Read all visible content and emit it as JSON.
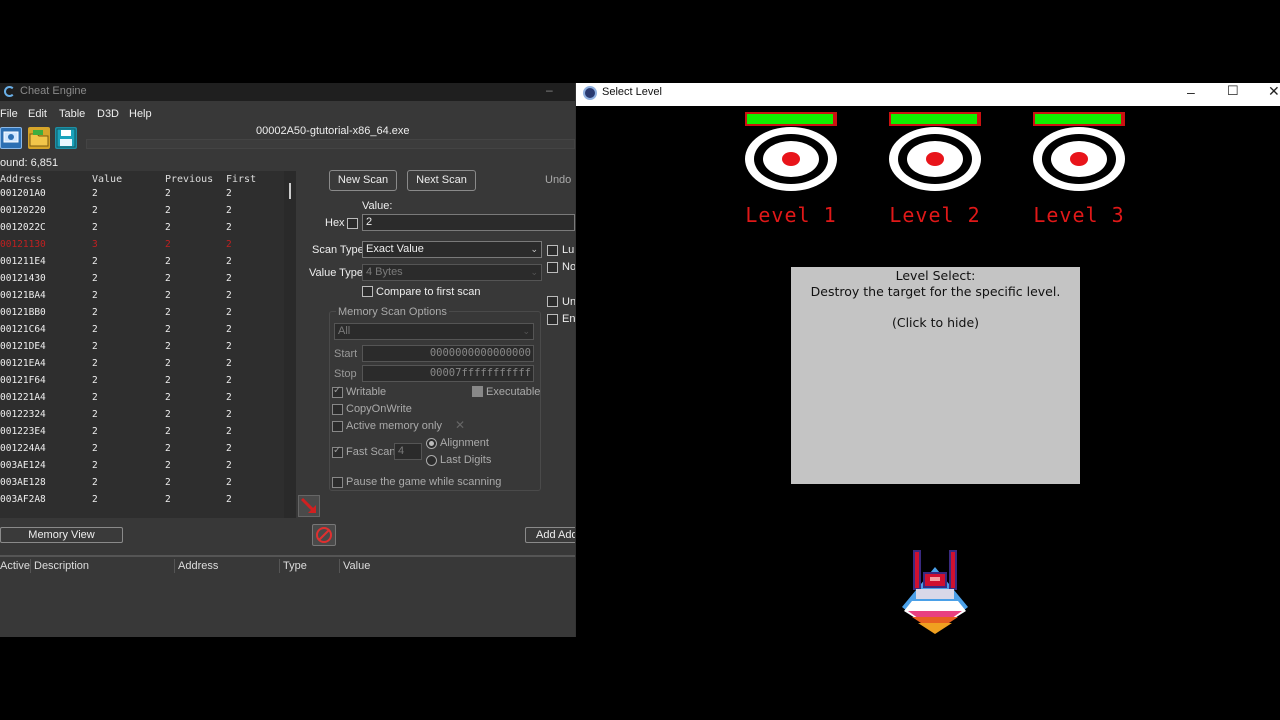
{
  "cheat_engine": {
    "title": "Cheat Engine",
    "menu": [
      "File",
      "Edit",
      "Table",
      "D3D",
      "Help"
    ],
    "process_name": "00002A50-gtutorial-x86_64.exe",
    "found_label": "ound: 6,851",
    "results_headers": [
      "Address",
      "Value",
      "Previous",
      "First"
    ],
    "results": [
      {
        "address": "001201A0",
        "value": "2",
        "previous": "2",
        "first": "2",
        "changed": false
      },
      {
        "address": "00120220",
        "value": "2",
        "previous": "2",
        "first": "2",
        "changed": false
      },
      {
        "address": "0012022C",
        "value": "2",
        "previous": "2",
        "first": "2",
        "changed": false
      },
      {
        "address": "00121130",
        "value": "3",
        "previous": "2",
        "first": "2",
        "changed": true
      },
      {
        "address": "001211E4",
        "value": "2",
        "previous": "2",
        "first": "2",
        "changed": false
      },
      {
        "address": "00121430",
        "value": "2",
        "previous": "2",
        "first": "2",
        "changed": false
      },
      {
        "address": "00121BA4",
        "value": "2",
        "previous": "2",
        "first": "2",
        "changed": false
      },
      {
        "address": "00121BB0",
        "value": "2",
        "previous": "2",
        "first": "2",
        "changed": false
      },
      {
        "address": "00121C64",
        "value": "2",
        "previous": "2",
        "first": "2",
        "changed": false
      },
      {
        "address": "00121DE4",
        "value": "2",
        "previous": "2",
        "first": "2",
        "changed": false
      },
      {
        "address": "00121EA4",
        "value": "2",
        "previous": "2",
        "first": "2",
        "changed": false
      },
      {
        "address": "00121F64",
        "value": "2",
        "previous": "2",
        "first": "2",
        "changed": false
      },
      {
        "address": "001221A4",
        "value": "2",
        "previous": "2",
        "first": "2",
        "changed": false
      },
      {
        "address": "00122324",
        "value": "2",
        "previous": "2",
        "first": "2",
        "changed": false
      },
      {
        "address": "001223E4",
        "value": "2",
        "previous": "2",
        "first": "2",
        "changed": false
      },
      {
        "address": "001224A4",
        "value": "2",
        "previous": "2",
        "first": "2",
        "changed": false
      },
      {
        "address": "003AE124",
        "value": "2",
        "previous": "2",
        "first": "2",
        "changed": false
      },
      {
        "address": "003AE128",
        "value": "2",
        "previous": "2",
        "first": "2",
        "changed": false
      },
      {
        "address": "003AF2A8",
        "value": "2",
        "previous": "2",
        "first": "2",
        "changed": false
      }
    ],
    "scan": {
      "new_scan": "New Scan",
      "next_scan": "Next Scan",
      "undo": "Undo",
      "value_label": "Value:",
      "hex_label": "Hex",
      "value_input": "2",
      "scan_type_label": "Scan Type",
      "scan_type_value": "Exact Value",
      "value_type_label": "Value Type",
      "value_type_value": "4 Bytes",
      "compare_first": "Compare to first scan",
      "right_checks": [
        "Lu",
        "No",
        "Un",
        "En"
      ]
    },
    "memory_options": {
      "title": "Memory Scan Options",
      "region": "All",
      "start_label": "Start",
      "start_value": "0000000000000000",
      "stop_label": "Stop",
      "stop_value": "00007fffffffffff",
      "writable": "Writable",
      "executable": "Executable",
      "copy_on_write": "CopyOnWrite",
      "active_memory_only": "Active memory only",
      "fast_scan": "Fast Scan",
      "fast_scan_value": "4",
      "alignment": "Alignment",
      "last_digits": "Last Digits",
      "pause_game": "Pause the game while scanning"
    },
    "memory_view": "Memory View",
    "add_address": "Add Add",
    "table_headers": [
      "Active",
      "Description",
      "Address",
      "Type",
      "Value"
    ]
  },
  "game": {
    "title": "Select Level",
    "levels": [
      "Level 1",
      "Level 2",
      "Level 3"
    ],
    "level_health": [
      1,
      1,
      1
    ],
    "info": {
      "line1": "Level Select:",
      "line2": "Destroy the target for the specific level.",
      "line3": "(Click to hide)"
    },
    "colors": {
      "health_fill": "#11ee00",
      "health_border": "#cc1111",
      "level_text": "#e01818"
    }
  }
}
